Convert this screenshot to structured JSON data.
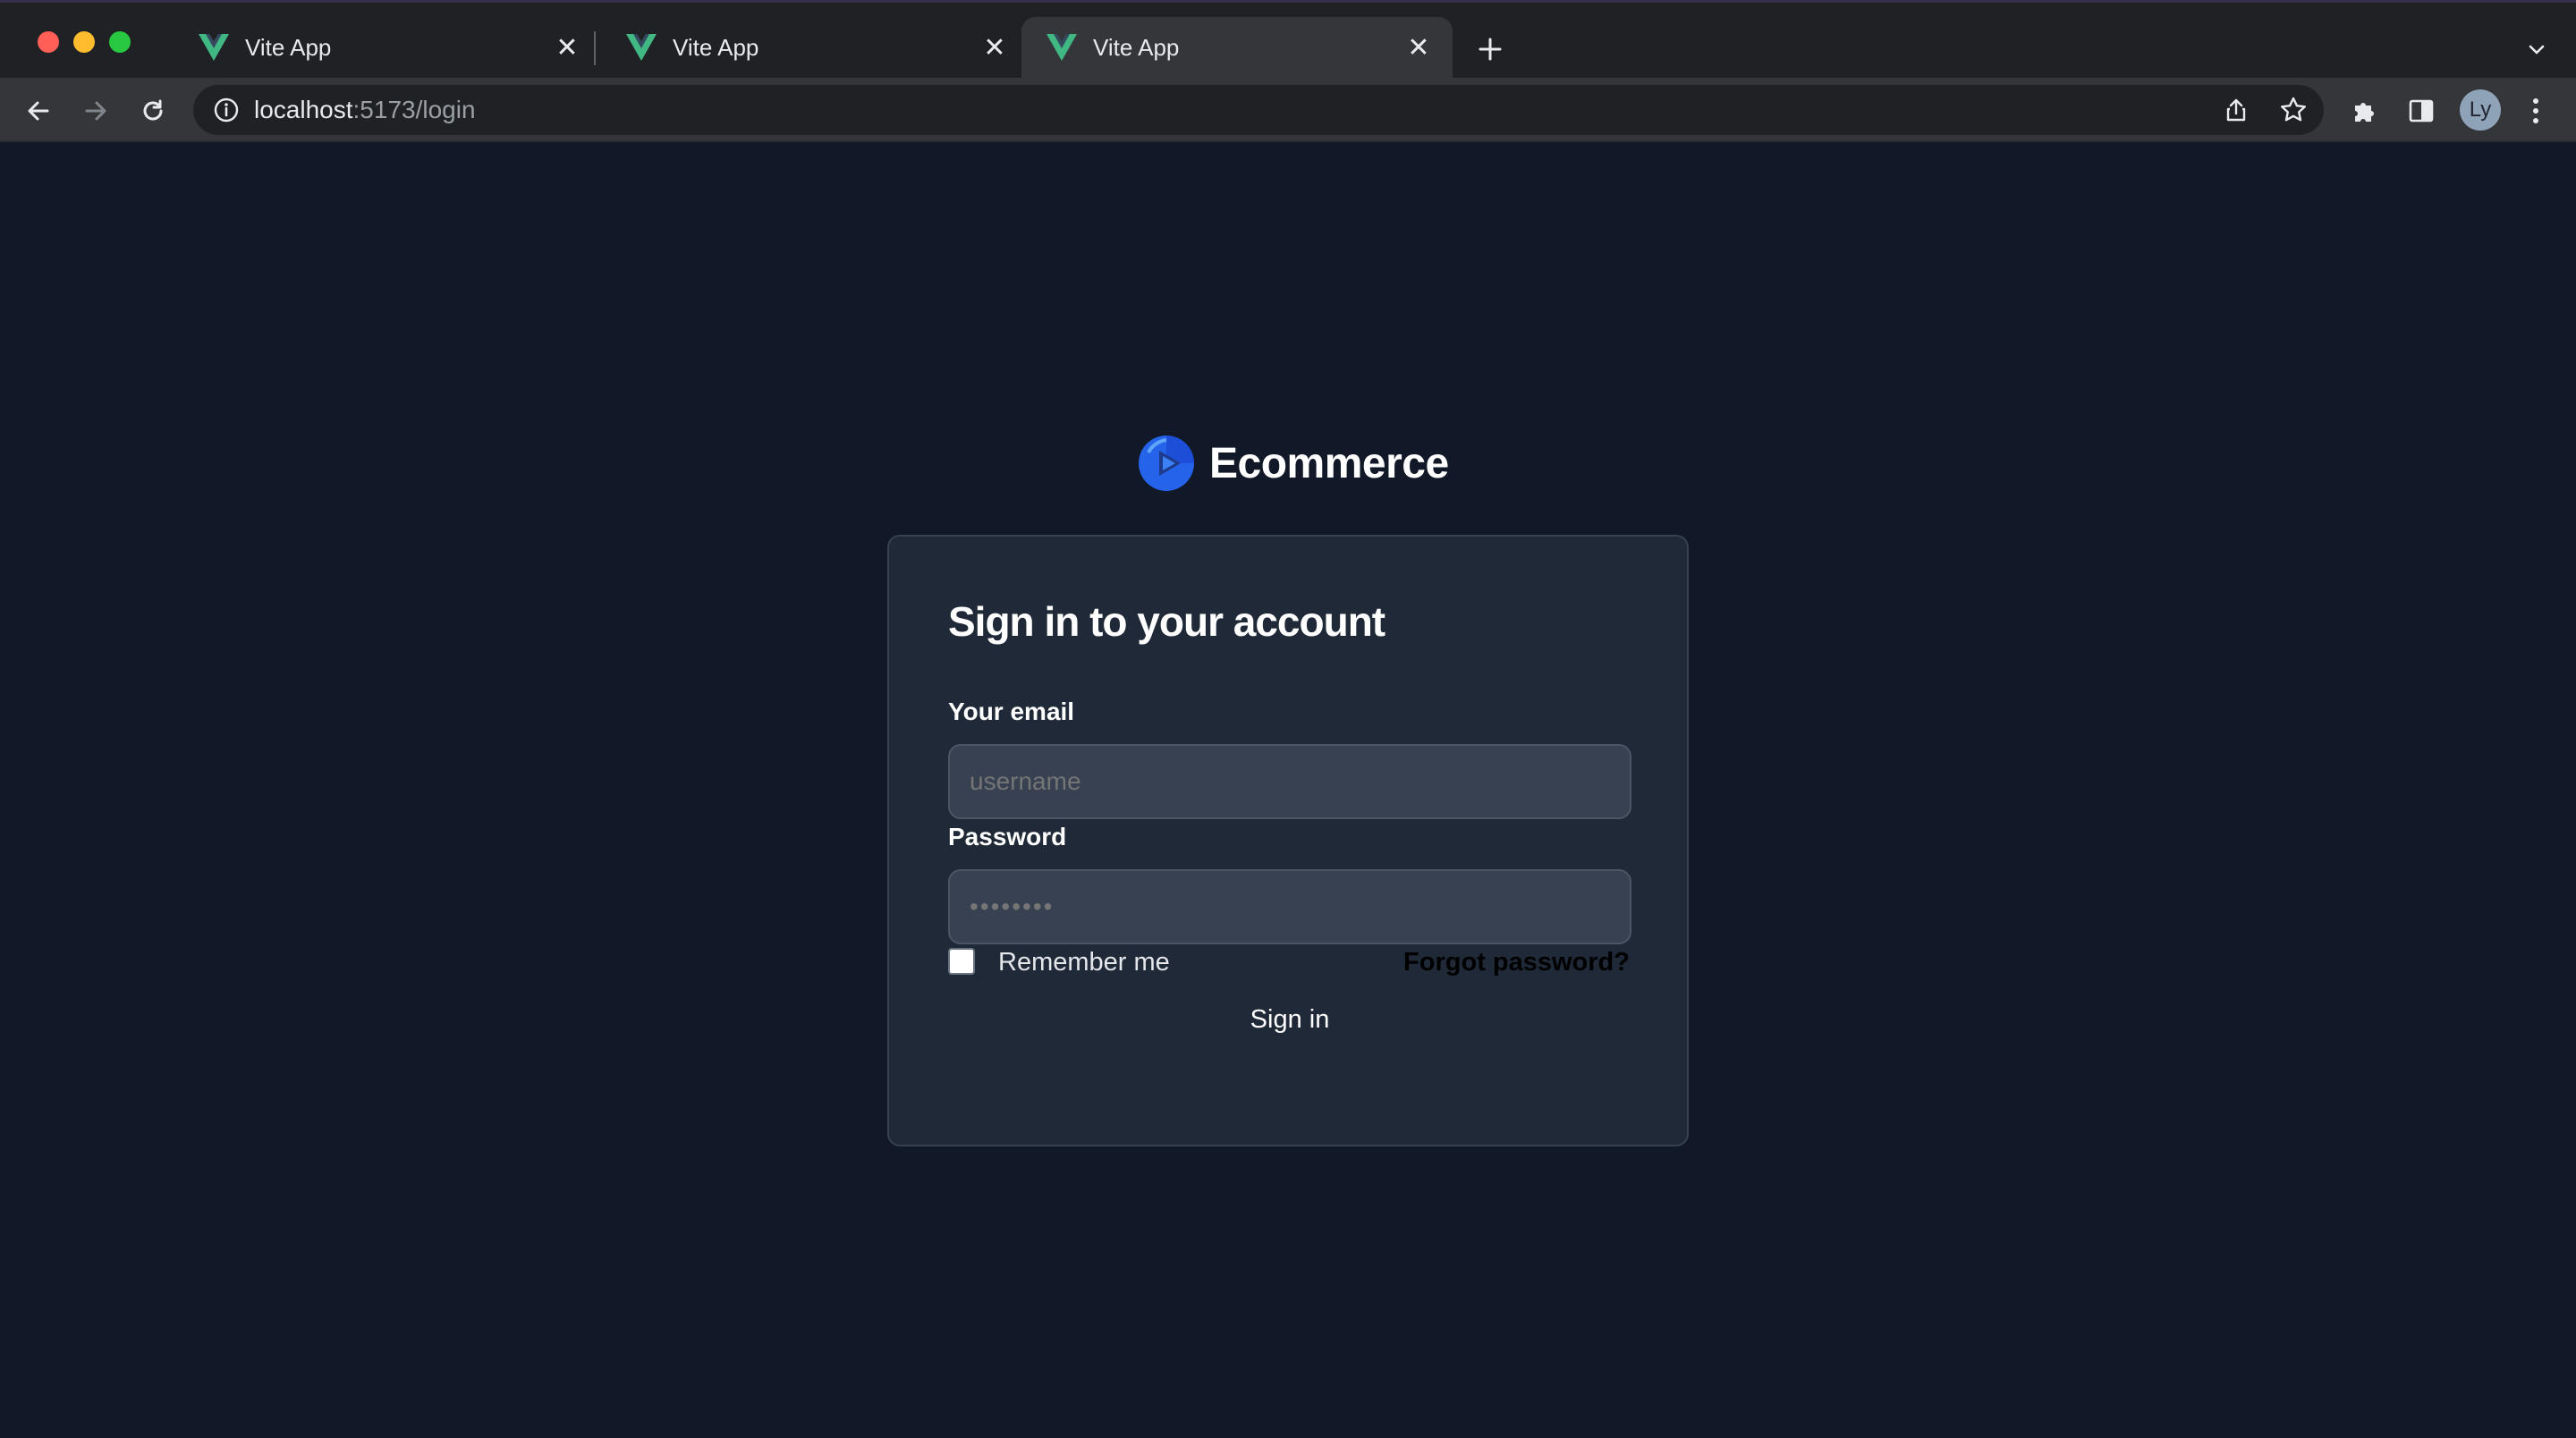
{
  "browser": {
    "tabs": [
      {
        "title": "Vite App",
        "icon": "vue-icon",
        "active": false
      },
      {
        "title": "Vite App",
        "icon": "vue-icon",
        "active": false
      },
      {
        "title": "Vite App",
        "icon": "vue-icon",
        "active": true
      }
    ],
    "url": {
      "host": "localhost",
      "path": ":5173/login"
    },
    "profile_initials": "Ly"
  },
  "page": {
    "brand": {
      "name": "Ecommerce",
      "logo": "ecommerce-logo-icon"
    },
    "form": {
      "title": "Sign in to your account",
      "email_label": "Your email",
      "email_placeholder": "username",
      "password_label": "Password",
      "password_placeholder": "••••••••",
      "remember_label": "Remember me",
      "remember_checked": false,
      "forgot_label": "Forgot password?",
      "submit_label": "Sign in"
    }
  },
  "colors": {
    "page_bg": "#111827",
    "card_bg": "#1f2937",
    "input_bg": "#374151"
  }
}
